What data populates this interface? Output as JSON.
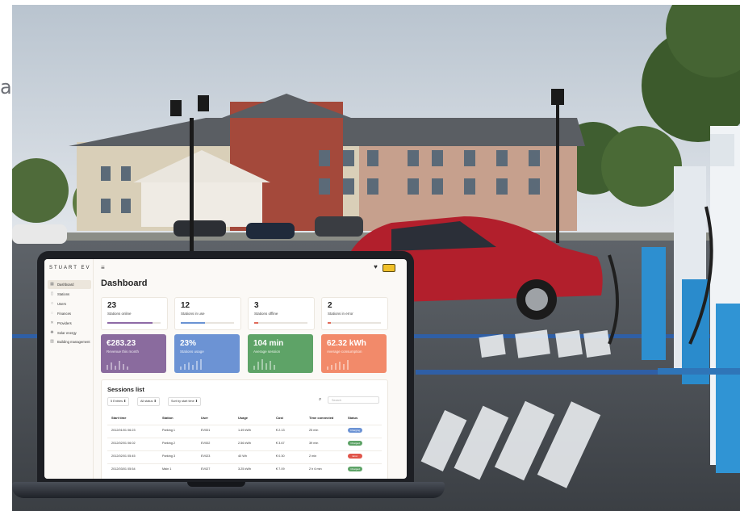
{
  "stray_text": "a",
  "app": {
    "logo": "STUART EV",
    "page_title": "Dashboard"
  },
  "sidebar": {
    "items": [
      {
        "label": "Dashboard",
        "icon": "grid-icon",
        "active": true
      },
      {
        "label": "Stations",
        "icon": "station-icon"
      },
      {
        "label": "Users",
        "icon": "user-icon"
      },
      {
        "label": "Finances",
        "icon": "finance-icon"
      },
      {
        "label": "Providers",
        "icon": "provider-icon"
      },
      {
        "label": "Solar energy",
        "icon": "sun-icon"
      },
      {
        "label": "Building management",
        "icon": "building-icon"
      }
    ]
  },
  "stats": [
    {
      "value": "23",
      "label": "Stations online",
      "bar_color": "#8e6aa6",
      "fill_fraction": 0.85
    },
    {
      "value": "12",
      "label": "Stations in use",
      "bar_color": "#6a93d3",
      "fill_fraction": 0.45
    },
    {
      "value": "3",
      "label": "Stations offline",
      "bar_color": "#e06a5a",
      "fill_fraction": 0.08
    },
    {
      "value": "2",
      "label": "Stations in error",
      "bar_color": "#e06a5a",
      "fill_fraction": 0.06
    }
  ],
  "kpis": [
    {
      "value": "€283.23",
      "label": "Revenue this month",
      "color": "#8a6b9e"
    },
    {
      "value": "23%",
      "label": "Stations usage",
      "color": "#6c93d4"
    },
    {
      "value": "104 min",
      "label": "Average session",
      "color": "#5ea367"
    },
    {
      "value": "62.32 kWh",
      "label": "Average consumption",
      "color": "#f28a6a"
    }
  ],
  "sessions": {
    "title": "Sessions list",
    "entries_select": "5 Entries",
    "status_select": "All status",
    "sort_select": "Sort by start time",
    "search_placeholder": "Search",
    "columns": [
      "Start time",
      "Station",
      "User",
      "Usage",
      "Cost",
      "Time connected",
      "Status"
    ],
    "rows": [
      {
        "start": "2012/01/01 06:23",
        "station": "Parking 1",
        "user": "EV001",
        "usage": "1.49 kWh",
        "cost": "€ 2.13",
        "time": "25 min",
        "status": "Charging",
        "status_color": "#6c93d4"
      },
      {
        "start": "2012/02/01 06:02",
        "station": "Parking 2",
        "user": "EV002",
        "usage": "2.56 kWh",
        "cost": "€ 3.67",
        "time": "39 min",
        "status": "Charged",
        "status_color": "#5ea367"
      },
      {
        "start": "2012/02/01 05:45",
        "station": "Parking 3",
        "user": "EV023",
        "usage": "40 Wh",
        "cost": "€ 0.30",
        "time": "2 min",
        "status": "Error",
        "status_color": "#e0554a"
      },
      {
        "start": "2012/03/01 05:54",
        "station": "Main 1",
        "user": "EV027",
        "usage": "3.25 kWh",
        "cost": "€ 7.09",
        "time": "2 h 6 min",
        "status": "Charged",
        "status_color": "#5ea367"
      }
    ]
  }
}
